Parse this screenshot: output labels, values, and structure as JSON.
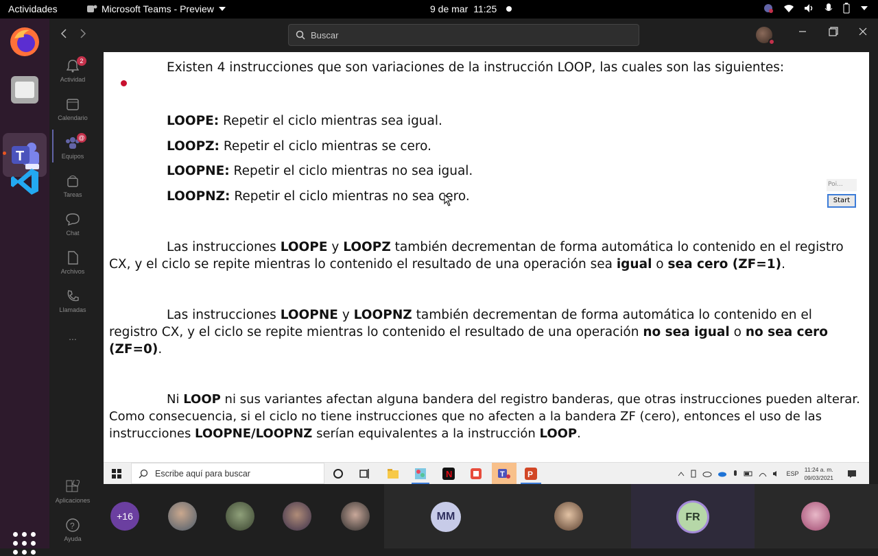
{
  "topbar": {
    "activities": "Actividades",
    "app_name": "Microsoft Teams - Preview",
    "date": "9 de mar",
    "time": "11:25"
  },
  "rail": {
    "items": [
      {
        "label": "Actividad",
        "badge": "2"
      },
      {
        "label": "Calendario"
      },
      {
        "label": "Equipos",
        "badge": "@"
      },
      {
        "label": "Tareas"
      },
      {
        "label": "Chat"
      },
      {
        "label": "Archivos"
      },
      {
        "label": "Llamadas"
      },
      {
        "label": "..."
      }
    ],
    "apps_label": "Aplicaciones",
    "help_label": "Ayuda"
  },
  "header": {
    "search_placeholder": "Buscar"
  },
  "document": {
    "intro": "Existen 4 instrucciones que son variaciones de la instrucción LOOP, las cuales son las siguientes:",
    "items": [
      {
        "term": "LOOPE:",
        "desc": " Repetir el ciclo mientras sea igual."
      },
      {
        "term": "LOOPZ:",
        "desc": " Repetir el ciclo mientras se cero."
      },
      {
        "term": "LOOPNE:",
        "desc": " Repetir el ciclo mientras no sea igual."
      },
      {
        "term": "LOOPNZ:",
        "desc": " Repetir el ciclo mientras no sea cero."
      }
    ],
    "para1": {
      "t1": "Las instrucciones ",
      "b1": "LOOPE",
      "t2": " y ",
      "b2": "LOOPZ",
      "t3": " también decrementan de forma automática lo contenido en el registro CX, y el ciclo se repite mientras lo contenido el resultado de una operación sea ",
      "b3": "igual",
      "t4": " o ",
      "b4": "sea cero (ZF=1)",
      "t5": "."
    },
    "para2": {
      "t1": "Las instrucciones ",
      "b1": "LOOPNE",
      "t2": " y ",
      "b2": "LOOPNZ",
      "t3": " también decrementan de forma automática lo contenido en el registro CX, y el ciclo se repite mientras lo contenido el resultado de una operación ",
      "b3": "no sea igual",
      "t4": " o ",
      "b4": "no sea cero (ZF=0)",
      "t5": "."
    },
    "para3": {
      "t1": "Ni ",
      "b1": "LOOP",
      "t2": " ni sus variantes afectan alguna bandera del registro banderas, que otras instrucciones pueden alterar. Como consecuencia, si el ciclo no tiene instrucciones que no afecten a la bandera ZF (cero), entonces el uso de las instrucciones ",
      "b2": "LOOPNE/LOOPNZ",
      "t3": " serían equivalentes a la instrucción ",
      "b3": "LOOP",
      "t4": "."
    },
    "widget_label": "Poi...",
    "widget_button": "Start"
  },
  "win_taskbar": {
    "search_placeholder": "Escribe aquí para buscar",
    "lang": "ESP",
    "time": "11:24 a. m.",
    "date": "09/03/2021"
  },
  "participants": {
    "overflow": "+16",
    "initials": [
      "MM",
      "FR"
    ]
  },
  "colors": {
    "accent": "#6264a7",
    "badge": "#c4314b",
    "dock_bg": "#2d1a2c"
  }
}
